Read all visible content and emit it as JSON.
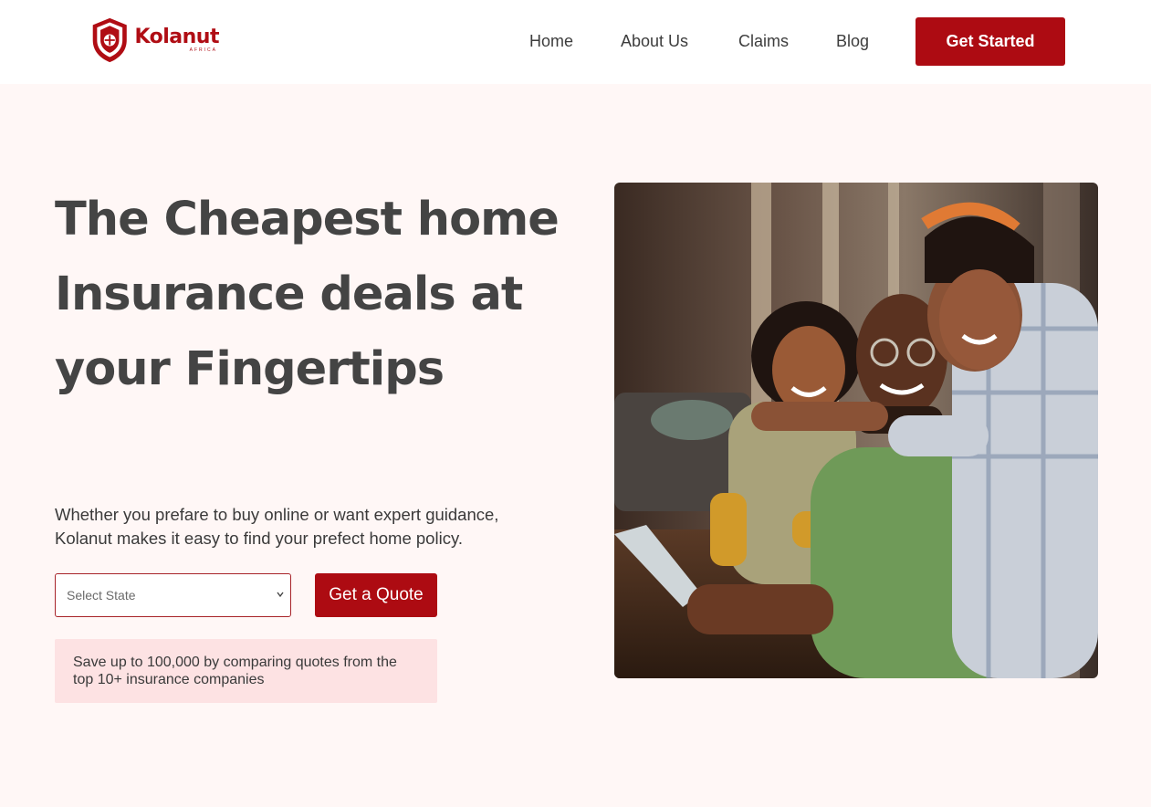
{
  "brand": {
    "name": "Kolanut",
    "tagline": "AFRICA",
    "color": "#b00d14"
  },
  "nav": {
    "items": [
      "Home",
      "About Us",
      "Claims",
      "Blog"
    ],
    "cta": "Get Started"
  },
  "hero": {
    "title": "The Cheapest home Insurance deals at your Fingertips",
    "subtitle": "Whether you prefare to buy online or want expert guidance, Kolanut makes it easy to find your prefect home policy.",
    "select_placeholder": "Select State",
    "quote_button": "Get a Quote",
    "savings_note": "Save up to 100,000 by comparing quotes from the top 10+ insurance companies"
  },
  "colors": {
    "accent": "#ad0b12",
    "page_bg": "#fff7f6",
    "note_bg": "#fde2e3"
  },
  "icons": {
    "logo": "shield-icon",
    "select": "chevron-down-icon"
  }
}
